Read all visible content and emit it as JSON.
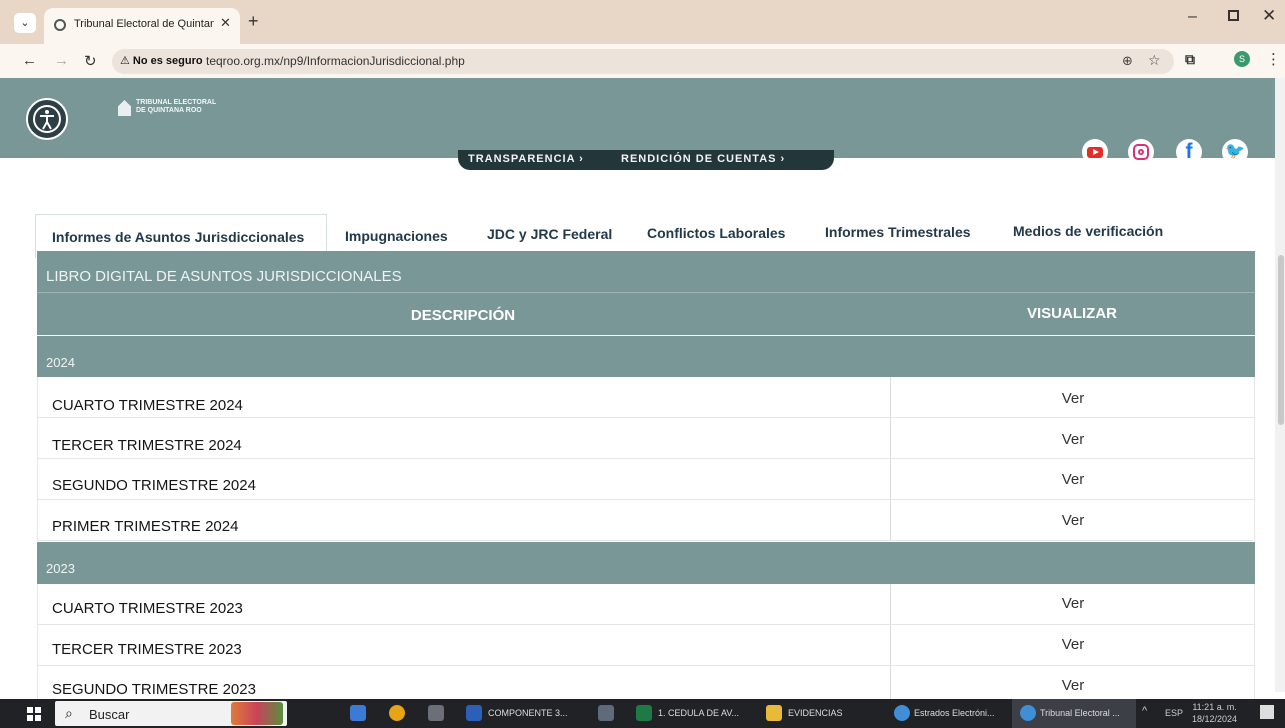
{
  "browser": {
    "tab_title": "Tribunal Electoral de Quintana",
    "security_label": "No es seguro",
    "url": "teqroo.org.mx/np9/InformacionJurisdiccional.php"
  },
  "site": {
    "logo_line1": "TRIBUNAL ELECTORAL",
    "logo_line2": "DE QUINTANA ROO",
    "nav": [
      "TRANSPARENCIA ›",
      "RENDICIÓN DE CUENTAS ›"
    ]
  },
  "tabs": [
    "Informes de Asuntos Jurisdiccionales",
    "Impugnaciones",
    "JDC y JRC Federal",
    "Conflictos Laborales",
    "Informes Trimestrales",
    "Medios de verificación"
  ],
  "table": {
    "caption": "LIBRO DIGITAL DE ASUNTOS JURISDICCIONALES",
    "col_desc": "DESCRIPCIÓN",
    "col_view": "VISUALIZAR",
    "groups": [
      {
        "year": "2024",
        "rows": [
          {
            "desc": "CUARTO TRIMESTRE 2024",
            "view": "Ver"
          },
          {
            "desc": "TERCER TRIMESTRE 2024",
            "view": "Ver"
          },
          {
            "desc": "SEGUNDO TRIMESTRE 2024",
            "view": "Ver"
          },
          {
            "desc": "PRIMER TRIMESTRE 2024",
            "view": "Ver"
          }
        ]
      },
      {
        "year": "2023",
        "rows": [
          {
            "desc": "CUARTO TRIMESTRE 2023",
            "view": "Ver"
          },
          {
            "desc": "TERCER TRIMESTRE 2023",
            "view": "Ver"
          },
          {
            "desc": "SEGUNDO TRIMESTRE 2023",
            "view": "Ver"
          }
        ]
      }
    ]
  },
  "taskbar": {
    "search_label": "Buscar",
    "items": [
      "COMPONENTE 3...",
      "1. CEDULA DE AV...",
      "EVIDENCIAS",
      "Estrados Electróni...",
      "Tribunal Electoral ..."
    ],
    "lang": "ESP",
    "time": "11:21 a. m.",
    "date": "18/12/2024"
  },
  "colors": {
    "header_teal": "#7a9797",
    "nav_dark": "#23373b",
    "tab_text": "#22394a"
  }
}
